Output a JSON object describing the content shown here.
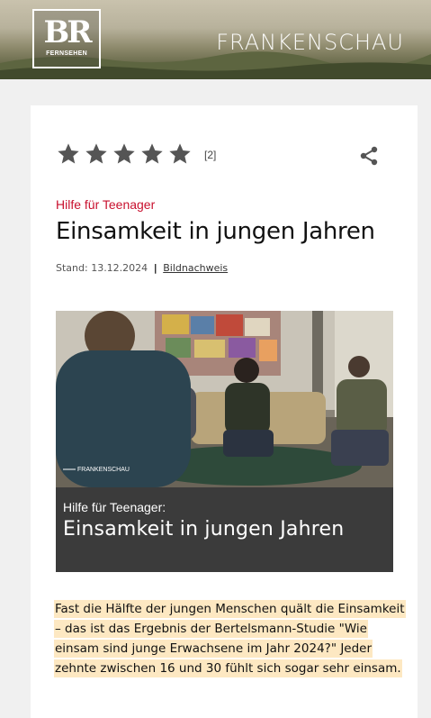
{
  "header": {
    "logo_text": "BR",
    "logo_subtext": "FERNSEHEN",
    "brand": "FRANKENSCHAU"
  },
  "article": {
    "rating": {
      "stars": 5,
      "count_label": "[2]"
    },
    "kicker": "Hilfe für Teenager",
    "headline": "Einsamkeit in jungen Jahren",
    "meta": {
      "stand": "Stand: 13.12.2024",
      "separator": "|",
      "credits_link": "Bildnachweis"
    },
    "media": {
      "watermark": "FRANKENSCHAU",
      "caption_kicker": "Hilfe für Teenager:",
      "caption_title": "Einsamkeit in jungen Jahren"
    },
    "lead": "Fast die Hälfte der jungen Menschen quält die Einsamkeit – das ist das Ergebnis der Bertelsmann-Studie \"Wie einsam sind junge Erwachsene im Jahr 2024?\" Jeder zehnte zwischen 16 und 30 fühlt sich sogar sehr einsam."
  },
  "colors": {
    "accent_red": "#c8102e",
    "highlight": "#fde8c2",
    "star": "#555555",
    "caption_bg": "#3b3b3b"
  }
}
